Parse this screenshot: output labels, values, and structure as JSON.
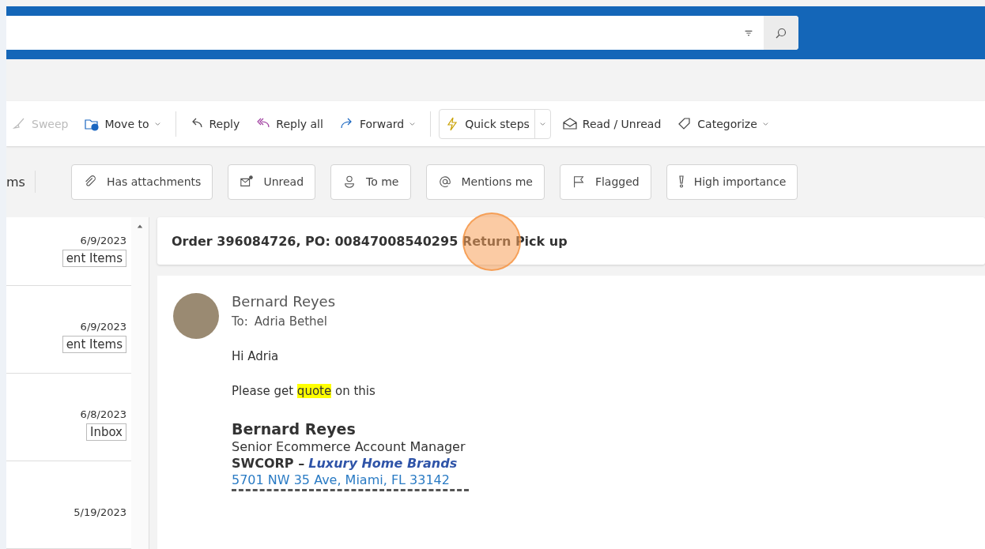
{
  "toolbar": [
    {
      "label": "Sweep",
      "disabled": true,
      "dropdown": false,
      "split": false
    },
    {
      "label": "Move to",
      "disabled": false,
      "dropdown": true,
      "split": false
    },
    {
      "label": "Reply",
      "disabled": false,
      "dropdown": false,
      "split": false
    },
    {
      "label": "Reply all",
      "disabled": false,
      "dropdown": false,
      "split": false
    },
    {
      "label": "Forward",
      "disabled": false,
      "dropdown": true,
      "split": false
    },
    {
      "label": "Quick steps",
      "disabled": false,
      "dropdown": true,
      "split": true
    },
    {
      "label": "Read / Unread",
      "disabled": false,
      "dropdown": false,
      "split": false
    },
    {
      "label": "Categorize",
      "disabled": false,
      "dropdown": true,
      "split": false
    }
  ],
  "filters": {
    "label": "ms",
    "chips": [
      {
        "label": "Has attachments",
        "selected": false
      },
      {
        "label": "Unread",
        "selected": false
      },
      {
        "label": "To me",
        "selected": false
      },
      {
        "label": "Mentions me",
        "selected": false
      },
      {
        "label": "Flagged",
        "selected": false
      },
      {
        "label": "High importance",
        "selected": false
      }
    ]
  },
  "message_list": [
    {
      "date": "6/9/2023",
      "folder": "ent Items"
    },
    {
      "date": "6/9/2023",
      "folder": "ent Items"
    },
    {
      "date": "6/8/2023",
      "folder": "Inbox"
    },
    {
      "date": "5/19/2023"
    }
  ],
  "reading_pane": {
    "subject": "Order 396084726, PO: 00847008540295 Return Pick up",
    "sender": "Bernard Reyes",
    "to_label": "To:",
    "to": "Adria Bethel",
    "greeting": "Hi Adria",
    "body": [
      {
        "text": "Please get ",
        "highlighted": false
      },
      {
        "text": "quote",
        "highlighted": true
      },
      {
        "text": " on this",
        "highlighted": false
      }
    ],
    "signature": {
      "name": "Bernard Reyes",
      "title": "Senior Ecommerce Account Manager",
      "company": "**SWCORP –** *Luxury Home Brands*",
      "address": "5701 NW 35 Ave, Miami, FL 33142"
    }
  }
}
